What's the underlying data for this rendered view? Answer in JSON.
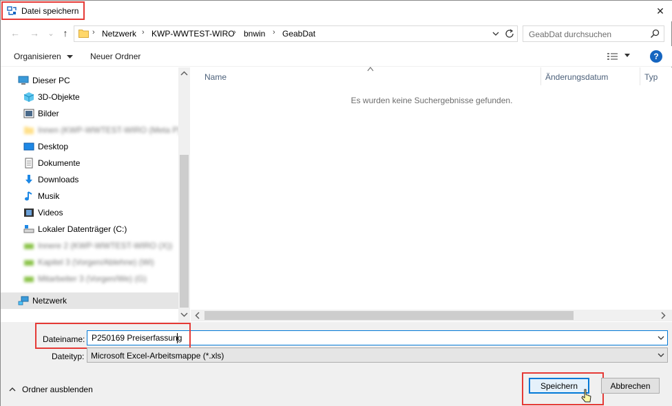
{
  "window": {
    "title": "Datei speichern",
    "close_glyph": "✕"
  },
  "nav_buttons": {
    "back_glyph": "←",
    "forward_glyph": "→",
    "recent_glyph": "⌄",
    "up_glyph": "↑"
  },
  "address": {
    "crumbs": [
      "Netzwerk",
      "KWP-WWTEST-WIRO",
      "bnwin",
      "GeabDat"
    ],
    "separator": "›"
  },
  "search": {
    "placeholder": "GeabDat durchsuchen"
  },
  "toolbar": {
    "organize_label": "Organisieren",
    "new_folder_label": "Neuer Ordner",
    "help_label": "?"
  },
  "nav_pane": {
    "items": [
      {
        "label": "Dieser PC",
        "icon": "monitor-icon"
      },
      {
        "label": "3D-Objekte",
        "icon": "cube-icon"
      },
      {
        "label": "Bilder",
        "icon": "pictures-icon"
      },
      {
        "label": "Innen (KWP-WWTEST-WIRO (Meta P)",
        "icon": "folder-icon",
        "blurred": true
      },
      {
        "label": "Desktop",
        "icon": "desktop-icon"
      },
      {
        "label": "Dokumente",
        "icon": "documents-icon"
      },
      {
        "label": "Downloads",
        "icon": "download-icon"
      },
      {
        "label": "Musik",
        "icon": "music-icon"
      },
      {
        "label": "Videos",
        "icon": "video-icon"
      },
      {
        "label": "Lokaler Datenträger (C:)",
        "icon": "drive-icon"
      },
      {
        "label": "Innere 2 (KWP-WWTEST-WIRO (X))",
        "icon": "network-drive-icon",
        "blurred": true
      },
      {
        "label": "Kapitel 3 (Vorgen/Ablehne) (Wi)",
        "icon": "network-drive-icon",
        "blurred": true
      },
      {
        "label": "Mitarbeiter 3 (Vorgen/We) (G)",
        "icon": "network-drive-icon",
        "blurred": true
      },
      {
        "label": "Netzwerk",
        "icon": "network-icon",
        "selected": true
      }
    ]
  },
  "file_list": {
    "columns": [
      "Name",
      "Änderungsdatum",
      "Typ"
    ],
    "empty_message": "Es wurden keine Suchergebnisse gefunden."
  },
  "form": {
    "filename_label": "Dateiname:",
    "filename_value": "P250169 Preiserfassung",
    "filetype_label": "Dateityp:",
    "filetype_value": "Microsoft Excel-Arbeitsmappe (*.xls)"
  },
  "footer": {
    "hide_folders_label": "Ordner ausblenden",
    "save_label": "Speichern",
    "cancel_label": "Abbrechen"
  },
  "colors": {
    "highlight": "#e53935",
    "accent": "#0078d7"
  }
}
